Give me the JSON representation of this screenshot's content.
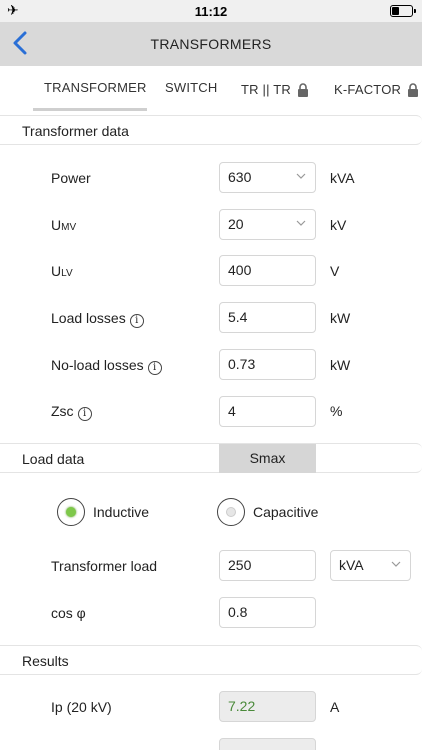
{
  "status": {
    "time": "11:12",
    "battery_level": 0.35
  },
  "nav": {
    "title": "TRANSFORMERS"
  },
  "tabs": [
    {
      "label": "TRANSFORMER",
      "active": true,
      "locked": false
    },
    {
      "label": "SWITCH",
      "active": false,
      "locked": false
    },
    {
      "label": "TR || TR",
      "active": false,
      "locked": true
    },
    {
      "label": "K-FACTOR",
      "active": false,
      "locked": true
    }
  ],
  "transformer_data": {
    "title": "Transformer data",
    "power": {
      "label": "Power",
      "value": "630",
      "unit": "kVA"
    },
    "umv": {
      "label_main": "U",
      "label_sub": "MV",
      "value": "20",
      "unit": "kV"
    },
    "ulv": {
      "label_main": "U",
      "label_sub": "LV",
      "value": "400",
      "unit": "V"
    },
    "load_losses": {
      "label": "Load losses",
      "value": "5.4",
      "unit": "kW"
    },
    "noload_losses": {
      "label": "No-load losses",
      "value": "0.73",
      "unit": "kW"
    },
    "zsc": {
      "label": "Zsc",
      "value": "4",
      "unit": "%"
    }
  },
  "load_data": {
    "title": "Load data",
    "mode_button": "Smax",
    "inductive": {
      "label": "Inductive",
      "selected": true
    },
    "capacitive": {
      "label": "Capacitive",
      "selected": false
    },
    "transformer_load": {
      "label": "Transformer load",
      "value": "250",
      "unit": "kVA"
    },
    "cos_phi": {
      "label": "cos φ",
      "value": "0.8"
    }
  },
  "results": {
    "title": "Results",
    "ip": {
      "label": "Ip (20 kV)",
      "value": "7.22",
      "unit": "A"
    }
  },
  "info_glyph": "i"
}
